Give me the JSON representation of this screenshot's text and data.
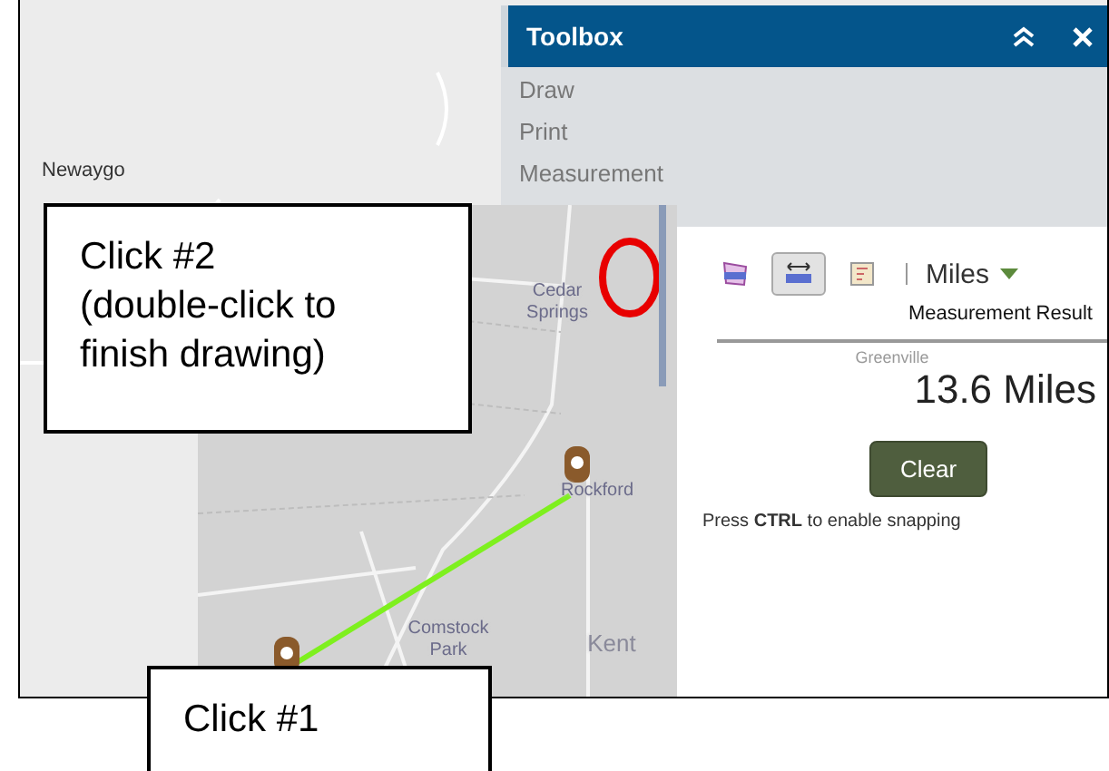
{
  "map": {
    "labels": [
      "Newaygo"
    ]
  },
  "toolbox": {
    "title": "Toolbox",
    "items": [
      "Draw",
      "Print",
      "Measurement"
    ]
  },
  "inset": {
    "labels": [
      "Cedar Springs",
      "Rockford",
      "Comstock Park",
      "Kent"
    ]
  },
  "measurement": {
    "tools": [
      {
        "kind": "area",
        "selected": false
      },
      {
        "kind": "distance",
        "selected": true
      },
      {
        "kind": "location",
        "selected": false
      }
    ],
    "unit": "Miles",
    "result_label": "Measurement Result",
    "background_label": "Greenville",
    "result": "13.6 Miles",
    "clear_button": "Clear",
    "hint": "Press **CTRL** to enable snapping"
  },
  "callouts": [
    [
      "Click #2",
      "(double-click to",
      "finish drawing)"
    ],
    [
      "Click #1"
    ]
  ]
}
